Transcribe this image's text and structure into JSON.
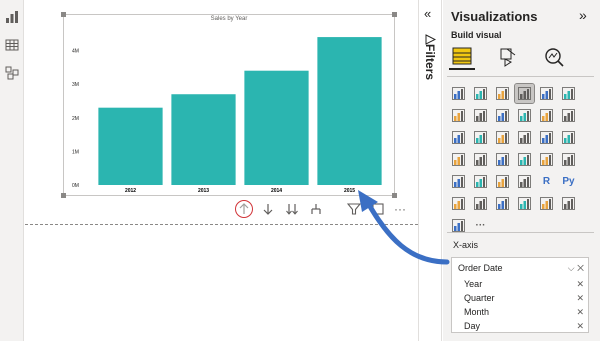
{
  "rail": {
    "icons": [
      "report-view-icon",
      "table-view-icon",
      "model-view-icon"
    ]
  },
  "visual": {
    "title": "Sales by Year",
    "more_label": "···"
  },
  "chart_data": {
    "type": "bar",
    "title": "Sales by Year",
    "categories": [
      "2012",
      "2013",
      "2014",
      "2015"
    ],
    "values": [
      2.3,
      2.7,
      3.4,
      4.4
    ],
    "ylim": [
      0,
      4.7
    ],
    "yticks": [
      "0M",
      "1M",
      "2M",
      "3M",
      "4M"
    ],
    "ytick_values": [
      0,
      1,
      2,
      3,
      4
    ],
    "bar_color": "#2bb5b0",
    "grid": false
  },
  "filters": {
    "label": "Filters",
    "collapse": "«"
  },
  "viz": {
    "title": "Visualizations",
    "expand": "»",
    "build_visual": "Build visual",
    "xaxis_label": "X-axis",
    "field": {
      "name": "Order Date",
      "children": [
        "Year",
        "Quarter",
        "Month",
        "Day"
      ]
    },
    "grid_text": {
      "r": "R",
      "py": "Py",
      "more": "···"
    }
  },
  "colors": {
    "accent": "#2bb5b0",
    "arrow": "#3b6fc4",
    "circle": "#d13438"
  }
}
